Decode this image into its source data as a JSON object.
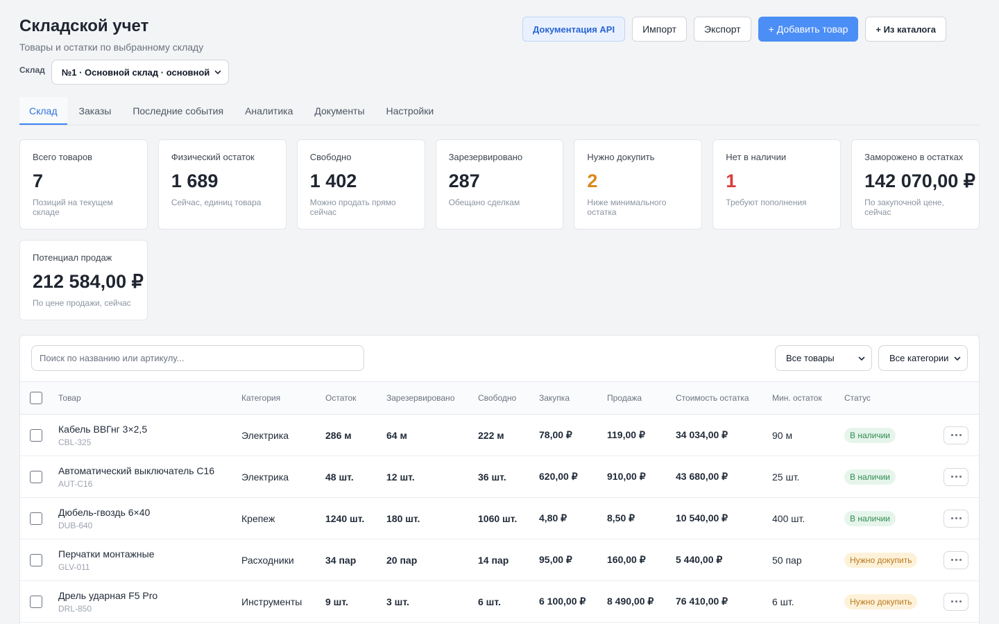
{
  "page": {
    "title": "Складской учет",
    "subtitle": "Товары и остатки по выбранному складу"
  },
  "warehouse": {
    "label": "Склад",
    "selected": "№1 · Основной склад · основной"
  },
  "toolbar": {
    "api_docs": "Документация API",
    "import": "Импорт",
    "export": "Экспорт",
    "add_product": "+ Добавить товар",
    "from_catalog": "+ Из каталога"
  },
  "tabs": [
    {
      "label": "Склад",
      "active": true
    },
    {
      "label": "Заказы",
      "active": false
    },
    {
      "label": "Последние события",
      "active": false
    },
    {
      "label": "Аналитика",
      "active": false
    },
    {
      "label": "Документы",
      "active": false
    },
    {
      "label": "Настройки",
      "active": false
    }
  ],
  "stats": [
    {
      "label": "Всего товаров",
      "value": "7",
      "hint": "Позиций на текущем складе"
    },
    {
      "label": "Физический остаток",
      "value": "1 689",
      "hint": "Сейчас, единиц товара"
    },
    {
      "label": "Свободно",
      "value": "1 402",
      "hint": "Можно продать прямо сейчас"
    },
    {
      "label": "Зарезервировано",
      "value": "287",
      "hint": "Обещано сделкам"
    },
    {
      "label": "Нужно докупить",
      "value": "2",
      "hint": "Ниже минимального остатка",
      "value_color": "#d98a1c"
    },
    {
      "label": "Нет в наличии",
      "value": "1",
      "hint": "Требуют пополнения",
      "value_color": "#dc3b3b"
    },
    {
      "label": "Заморожено в остатках",
      "value": "142 070,00 ₽",
      "hint": "По закупочной цене, сейчас"
    },
    {
      "label": "Потенциал продаж",
      "value": "212 584,00 ₽",
      "hint": "По цене продажи, сейчас"
    }
  ],
  "filters": {
    "search_placeholder": "Поиск по названию или артикулу...",
    "product_filter": "Все товары",
    "category_filter": "Все категории"
  },
  "table": {
    "columns": [
      "Товар",
      "Категория",
      "Остаток",
      "Зарезервировано",
      "Свободно",
      "Закупка",
      "Продажа",
      "Стоимость остатка",
      "Мин. остаток",
      "Статус"
    ],
    "rows": [
      {
        "name": "Кабель ВВГнг 3×2,5",
        "sku": "CBL-325",
        "category": "Электрика",
        "stock": "286 м",
        "reserved": "64 м",
        "free": "222 м",
        "purchase_price": "78,00 ₽",
        "sale_price": "119,00 ₽",
        "stock_value": "34 034,00 ₽",
        "min_stock": "90 м",
        "status": {
          "label": "В наличии",
          "bg": "#e6f5eb",
          "fg": "#2f8a50"
        }
      },
      {
        "name": "Автоматический выключатель С16",
        "sku": "AUT-C16",
        "category": "Электрика",
        "stock": "48 шт.",
        "reserved": "12 шт.",
        "free": "36 шт.",
        "purchase_price": "620,00 ₽",
        "sale_price": "910,00 ₽",
        "stock_value": "43 680,00 ₽",
        "min_stock": "25 шт.",
        "status": {
          "label": "В наличии",
          "bg": "#e6f5eb",
          "fg": "#2f8a50"
        }
      },
      {
        "name": "Дюбель-гвоздь 6×40",
        "sku": "DUB-640",
        "category": "Крепеж",
        "stock": "1240 шт.",
        "reserved": "180 шт.",
        "free": "1060 шт.",
        "purchase_price": "4,80 ₽",
        "sale_price": "8,50 ₽",
        "stock_value": "10 540,00 ₽",
        "min_stock": "400 шт.",
        "status": {
          "label": "В наличии",
          "bg": "#e6f5eb",
          "fg": "#2f8a50"
        }
      },
      {
        "name": "Перчатки монтажные",
        "sku": "GLV-011",
        "category": "Расходники",
        "stock": "34 пар",
        "reserved": "20 пар",
        "free": "14 пар",
        "purchase_price": "95,00 ₽",
        "sale_price": "160,00 ₽",
        "stock_value": "5 440,00 ₽",
        "min_stock": "50 пар",
        "status": {
          "label": "Нужно докупить",
          "bg": "#fdf2d9",
          "fg": "#b9771c"
        }
      },
      {
        "name": "Дрель ударная F5 Pro",
        "sku": "DRL-850",
        "category": "Инструменты",
        "stock": "9 шт.",
        "reserved": "3 шт.",
        "free": "6 шт.",
        "purchase_price": "6 100,00 ₽",
        "sale_price": "8 490,00 ₽",
        "stock_value": "76 410,00 ₽",
        "min_stock": "6 шт.",
        "status": {
          "label": "Нужно докупить",
          "bg": "#fdf2d9",
          "fg": "#b9771c"
        }
      }
    ]
  },
  "icons": {
    "select_chevron": "chevron-down-icon",
    "row_menu": "more-icon"
  },
  "colors": {
    "accent": "#3b82f6",
    "primary_button": "#4b8ef6",
    "warning": "#d98a1c",
    "danger": "#dc3b3b",
    "success": "#2f8a50"
  }
}
